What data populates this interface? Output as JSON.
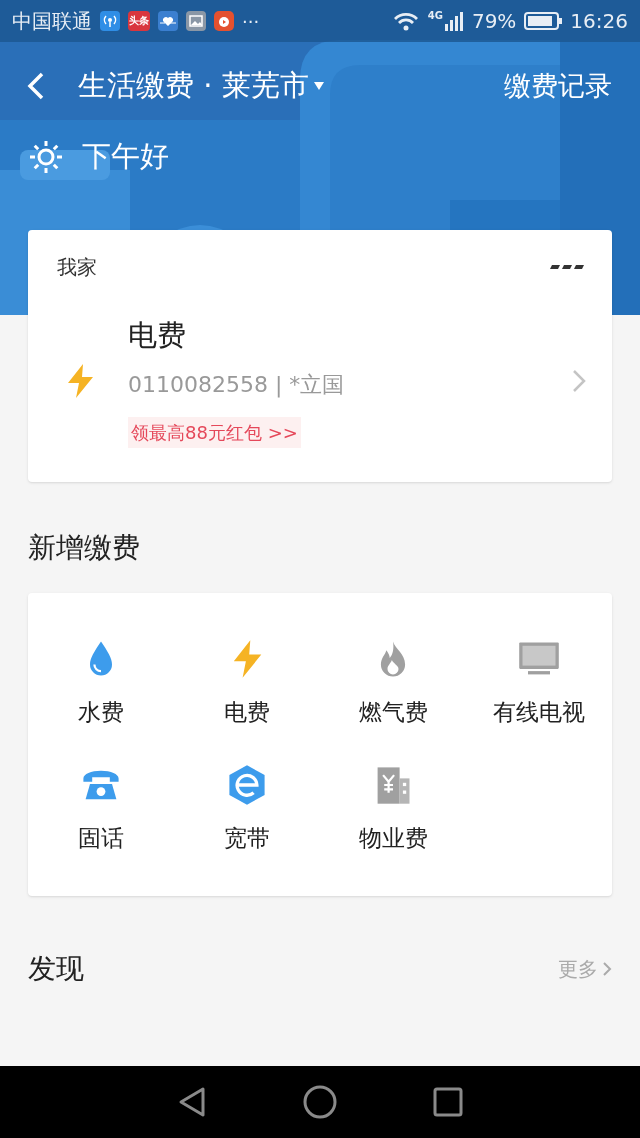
{
  "status_bar": {
    "carrier": "中国联通",
    "notifications": [
      {
        "kind": "hotspot"
      },
      {
        "kind": "news",
        "label": "头条"
      },
      {
        "kind": "health"
      },
      {
        "kind": "gallery"
      },
      {
        "kind": "video"
      }
    ],
    "more": "···",
    "network": "4G",
    "battery": "79%",
    "time": "16:26"
  },
  "header": {
    "title": "生活缴费 · 莱芜市",
    "action": "缴费记录",
    "greeting": "下午好"
  },
  "my_bills": {
    "group": "我家",
    "bills": [
      {
        "kind": "electricity",
        "name": "电费",
        "account": "0110082558 | *立国",
        "promo": "领最高88元红包 >>"
      }
    ]
  },
  "add_payment": {
    "title": "新增缴费",
    "items": [
      {
        "kind": "water",
        "label": "水费"
      },
      {
        "kind": "electricity",
        "label": "电费"
      },
      {
        "kind": "gas",
        "label": "燃气费"
      },
      {
        "kind": "tv",
        "label": "有线电视"
      },
      {
        "kind": "phone",
        "label": "固话"
      },
      {
        "kind": "broadband",
        "label": "宽带"
      },
      {
        "kind": "property",
        "label": "物业费"
      }
    ]
  },
  "discover": {
    "title": "发现",
    "more": "更多"
  }
}
